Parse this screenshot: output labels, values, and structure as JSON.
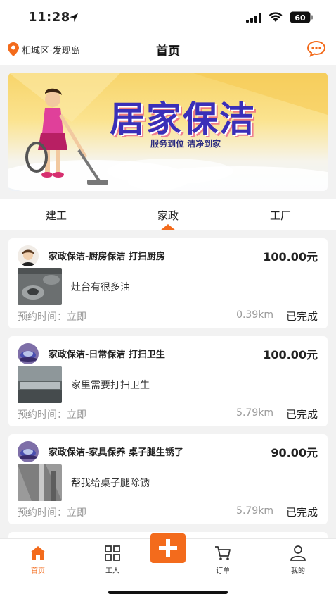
{
  "status_bar": {
    "time": "11:28",
    "battery": "60"
  },
  "header": {
    "location": "相城区-发现岛",
    "title": "首页"
  },
  "banner": {
    "title": "居家保洁",
    "subtitle": "服务到位 洁净到家"
  },
  "tabs": [
    {
      "label": "建工",
      "active": false
    },
    {
      "label": "家政",
      "active": true
    },
    {
      "label": "工厂",
      "active": false
    }
  ],
  "orders": [
    {
      "title": "家政保洁-厨房保洁 打扫厨房",
      "price": "100.00元",
      "description": "灶台有很多油",
      "appointment": "预约时间：立即",
      "distance": "0.39km",
      "status": "已完成"
    },
    {
      "title": "家政保洁-日常保洁 打扫卫生",
      "price": "100.00元",
      "description": "家里需要打扫卫生",
      "appointment": "预约时间：立即",
      "distance": "5.79km",
      "status": "已完成"
    },
    {
      "title": "家政保洁-家具保养 桌子腿生锈了",
      "price": "90.00元",
      "description": "帮我给桌子腿除锈",
      "appointment": "预约时间：立即",
      "distance": "5.79km",
      "status": "已完成"
    }
  ],
  "bottom_nav": [
    {
      "label": "首页",
      "icon": "home-icon",
      "active": true
    },
    {
      "label": "工人",
      "icon": "grid-icon",
      "active": false
    },
    {
      "label": "",
      "icon": "plus-icon",
      "active": false
    },
    {
      "label": "订单",
      "icon": "cart-icon",
      "active": false
    },
    {
      "label": "我的",
      "icon": "user-icon",
      "active": false
    }
  ],
  "colors": {
    "accent": "#f36b1c",
    "background": "#f2f2f2",
    "text": "#222222",
    "muted": "#999999"
  }
}
